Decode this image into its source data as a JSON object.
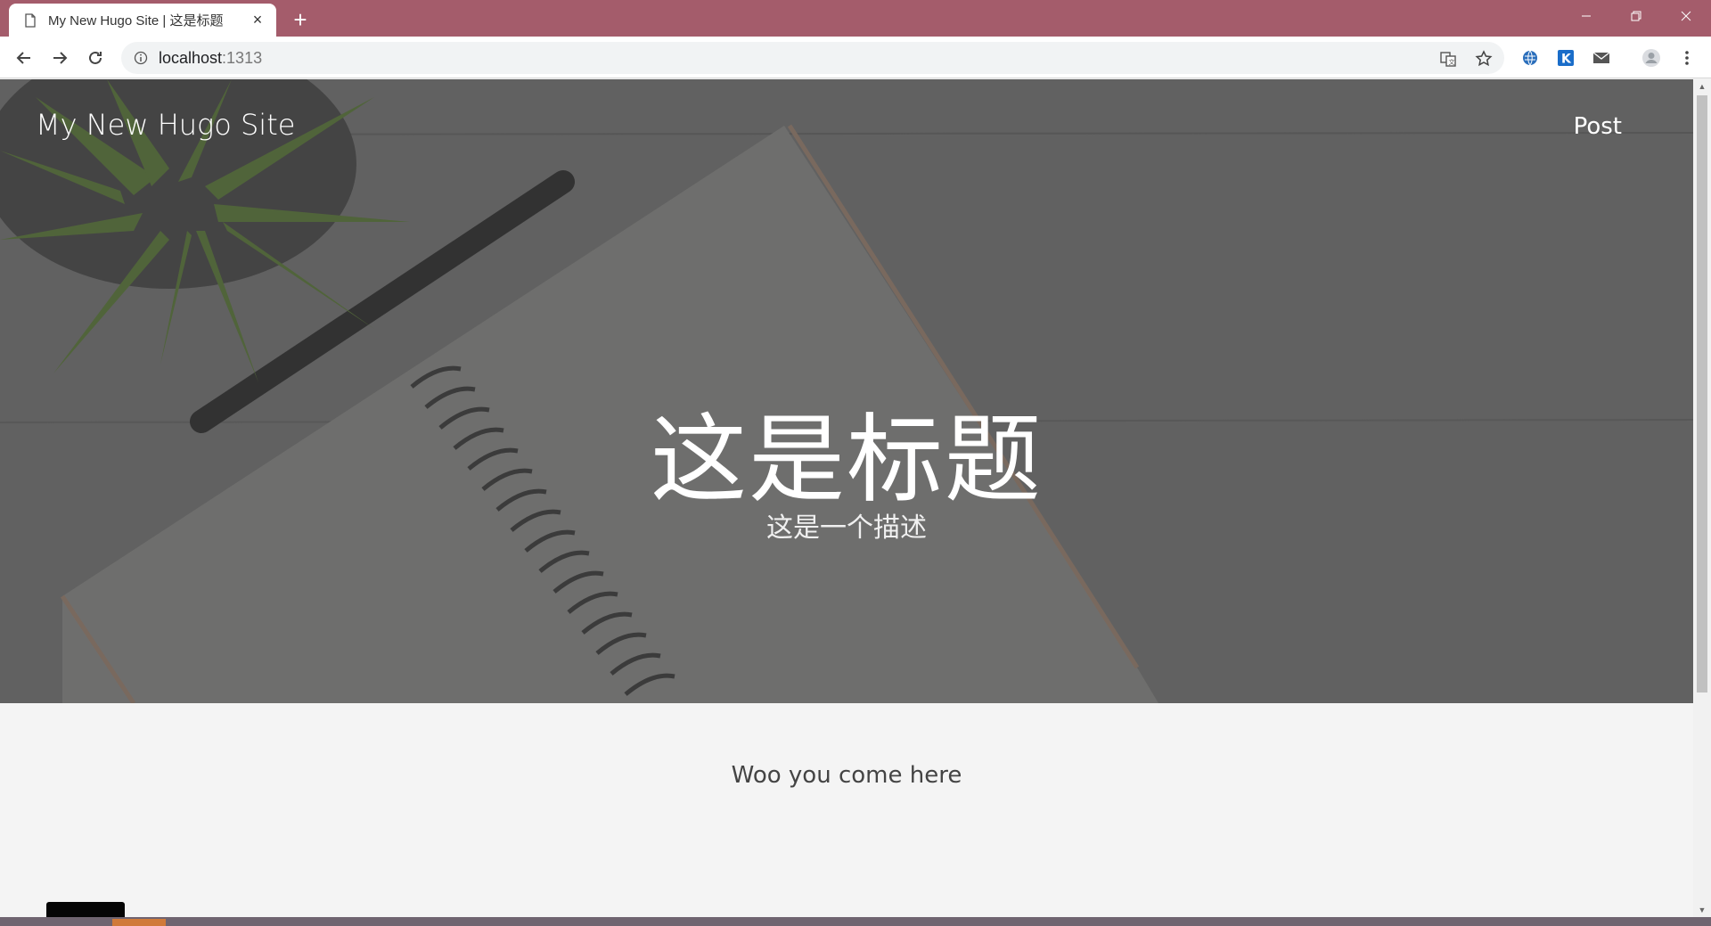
{
  "browser": {
    "tab_title": "My New Hugo Site | 这是标题",
    "tab_close": "×",
    "new_tab": "+",
    "url_host": "localhost",
    "url_port": ":1313"
  },
  "site": {
    "title": "My New Hugo Site",
    "nav": {
      "post": "Post"
    }
  },
  "hero": {
    "title": "这是标题",
    "description": "这是一个描述"
  },
  "content": {
    "text": "Woo you come here"
  },
  "colors": {
    "tabstrip": "#a45c6b",
    "hero_overlay": "#646464",
    "page_bg": "#f4f4f4"
  }
}
